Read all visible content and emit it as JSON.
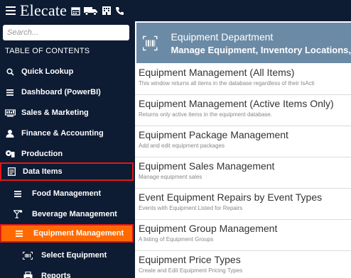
{
  "header": {
    "brand": "Elecate",
    "icons": [
      "menu-icon",
      "calendar-icon",
      "truck-icon",
      "building-icon",
      "phone-icon"
    ]
  },
  "sidebar": {
    "search_placeholder": "Search...",
    "toc_label": "TABLE OF CONTENTS",
    "items": [
      {
        "label": "Quick Lookup",
        "icon": "search-icon"
      },
      {
        "label": "Dashboard (PowerBI)",
        "icon": "list-icon"
      },
      {
        "label": "Sales & Marketing",
        "icon": "sales-icon"
      },
      {
        "label": "Finance & Accounting",
        "icon": "finance-icon"
      },
      {
        "label": "Production",
        "icon": "production-icon"
      },
      {
        "label": "Data Items",
        "icon": "data-items-icon"
      },
      {
        "label": "Food Management",
        "icon": "list-icon"
      },
      {
        "label": "Beverage Management",
        "icon": "cocktail-icon"
      },
      {
        "label": "Equipment Management",
        "icon": "list-icon"
      },
      {
        "label": "Select Equipment",
        "icon": "barcode-icon"
      },
      {
        "label": "Reports",
        "icon": "print-icon"
      }
    ],
    "colors": {
      "background": "#0d1b33",
      "active": "#ff6a00",
      "highlight_border": "#e01818"
    }
  },
  "main": {
    "department": {
      "title": "Equipment Department",
      "subtitle": "Manage Equipment, Inventory Locations,",
      "icon": "barcode-icon",
      "color": "#6b8aa6"
    },
    "items": [
      {
        "title": "Equipment Management (All Items)",
        "desc": "This window returns all items in the database regardless of their IsActi"
      },
      {
        "title": "Equipment Management (Active Items Only)",
        "desc": "Returns only active items in the equipment database."
      },
      {
        "title": "Equipment Package Management",
        "desc": "Add and edit equipment packages"
      },
      {
        "title": "Equipment Sales Management",
        "desc": "Manage equipment sales"
      },
      {
        "title": "Event Equipment Repairs by Event Types",
        "desc": "Events with Equipment Listed for Repairs"
      },
      {
        "title": "Equipment Group Management",
        "desc": "A listing of Equipment Groups"
      },
      {
        "title": "Equipment Price Types",
        "desc": "Create and Edit Equipment Pricing Types"
      }
    ]
  }
}
